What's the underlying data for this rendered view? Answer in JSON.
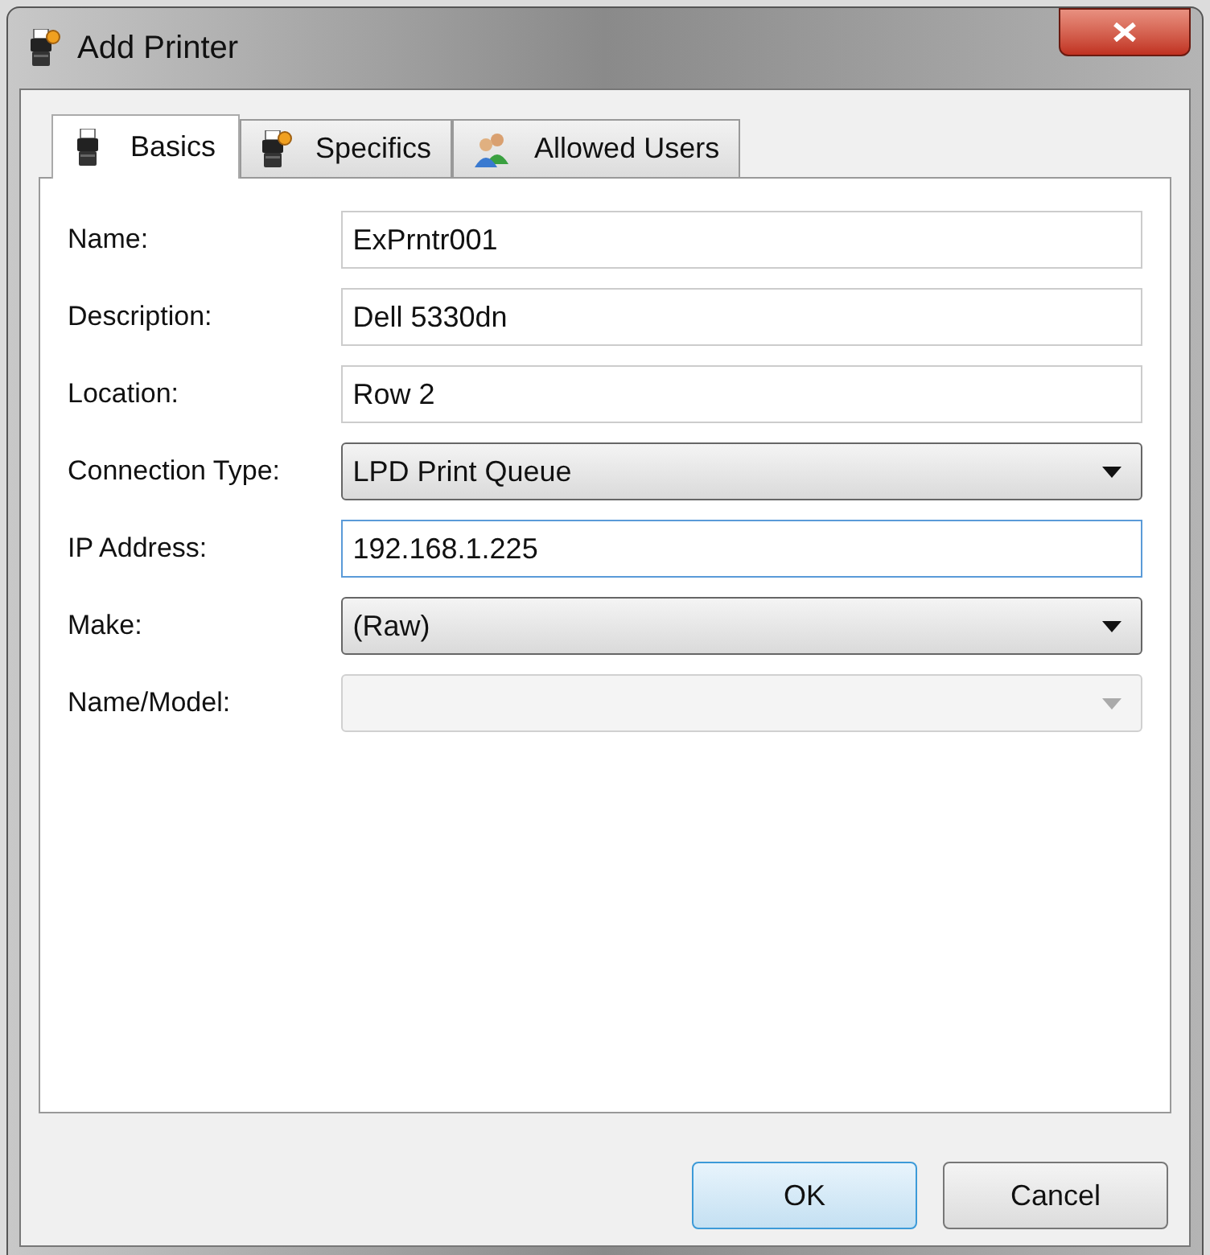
{
  "window": {
    "title": "Add Printer"
  },
  "tabs": [
    {
      "label": "Basics",
      "selected": true,
      "kind": "printer"
    },
    {
      "label": "Specifics",
      "selected": false,
      "kind": "printer-gear"
    },
    {
      "label": "Allowed Users",
      "selected": false,
      "kind": "users"
    }
  ],
  "fields": [
    {
      "label": "Name:",
      "kind": "text",
      "value": "ExPrntr001",
      "focused": false
    },
    {
      "label": "Description:",
      "kind": "text",
      "value": "Dell 5330dn",
      "focused": false
    },
    {
      "label": "Location:",
      "kind": "text",
      "value": "Row 2",
      "focused": false
    },
    {
      "label": "Connection Type:",
      "kind": "select",
      "value": "LPD Print Queue",
      "disabled": false
    },
    {
      "label": "IP Address:",
      "kind": "text",
      "value": "192.168.1.225",
      "focused": true
    },
    {
      "label": "Make:",
      "kind": "select",
      "value": "(Raw)",
      "disabled": false
    },
    {
      "label": "Name/Model:",
      "kind": "select",
      "disabled": true
    }
  ],
  "buttons": [
    {
      "label": "OK",
      "default": true
    },
    {
      "label": "Cancel",
      "default": false
    }
  ]
}
